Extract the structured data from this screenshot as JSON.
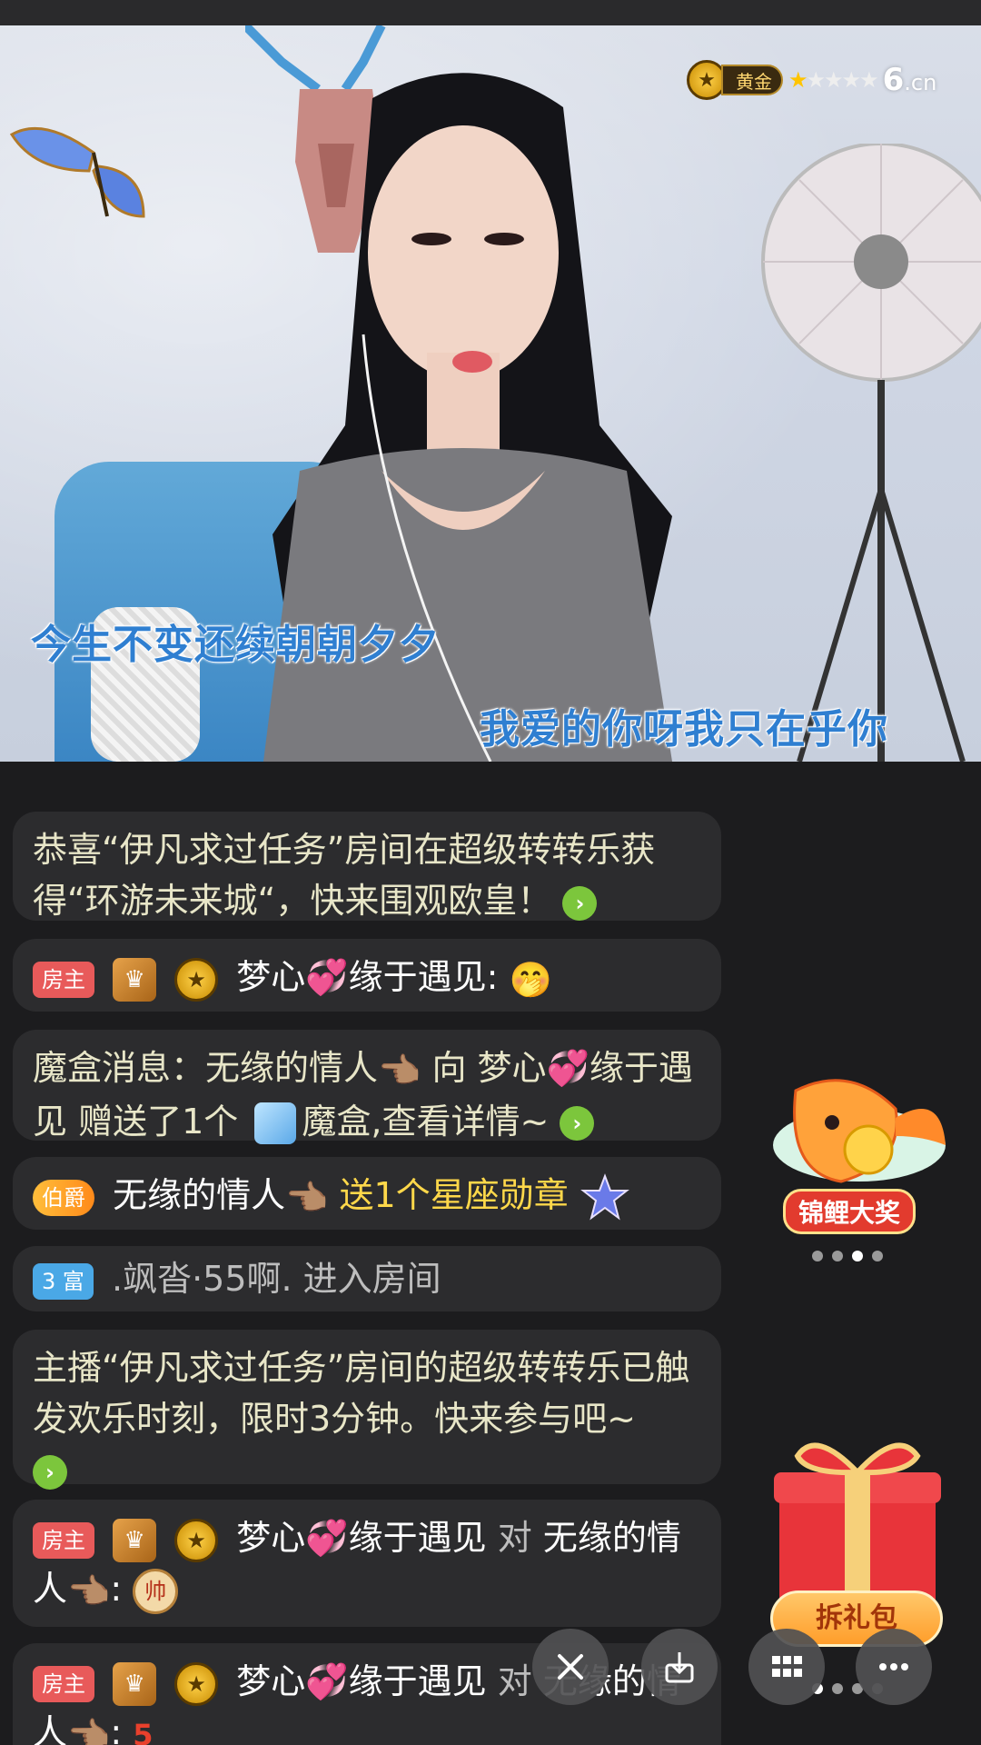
{
  "video": {
    "level_badge": {
      "label": "黄金",
      "stars_on": 1,
      "stars_total": 5
    },
    "site_logo": {
      "main": "6",
      "suffix": ".cn"
    },
    "lyrics": [
      "今生不变还续朝朝夕夕",
      "我爱的你呀我只在乎你"
    ]
  },
  "chat": {
    "messages": [
      {
        "text": "恭喜“伊凡求过任务”房间在超级转转乐获得“环游未来城“，快来围观欧皇！"
      },
      {
        "tag": "房主",
        "user": "梦心",
        "user_suffix": "缘于遇见:"
      },
      {
        "text_a": "魔盒消息：无缘的情人",
        "text_b": "向 梦心",
        "text_c": "缘于遇见 赠送了1个",
        "text_d": "魔盒,查看详情~"
      },
      {
        "tag": "伯爵",
        "user": "无缘的情人",
        "gift_text": "送1个星座勋章"
      },
      {
        "tag_num": "3",
        "tag": "富",
        "text": ".飒沓·55啊. 进入房间"
      },
      {
        "text": "主播“伊凡求过任务”房间的超级转转乐已触发欢乐时刻，限时3分钟。快来参与吧~"
      },
      {
        "tag": "房主",
        "user": "梦心",
        "user_suffix": "缘于遇见",
        "to": "对",
        "target": "无缘的情人",
        "colon": ":",
        "emoji_text": "帅"
      },
      {
        "tag": "房主",
        "user": "梦心",
        "user_suffix": "缘于遇见",
        "to": "对",
        "target": "无缘的情人",
        "colon": ":",
        "medal_num": "5"
      }
    ]
  },
  "widgets": {
    "koi_label": "锦鲤大奖",
    "giftpack_label": "拆礼包"
  }
}
